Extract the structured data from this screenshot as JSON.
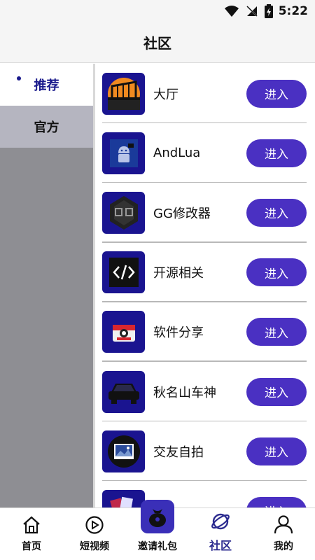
{
  "status_bar": {
    "time": "5:22"
  },
  "header": {
    "title": "社区"
  },
  "sidebar": {
    "items": [
      {
        "label": "推荐"
      },
      {
        "label": "官方"
      }
    ]
  },
  "list": {
    "items": [
      {
        "label": "大厅",
        "button": "进入",
        "icon": "bridge-icon"
      },
      {
        "label": "AndLua",
        "button": "进入",
        "icon": "android-robot-icon"
      },
      {
        "label": "GG修改器",
        "button": "进入",
        "icon": "gg-helmet-icon"
      },
      {
        "label": "开源相关",
        "button": "进入",
        "icon": "code-icon"
      },
      {
        "label": "软件分享",
        "button": "进入",
        "icon": "software-box-icon"
      },
      {
        "label": "秋名山车神",
        "button": "进入",
        "icon": "car-icon"
      },
      {
        "label": "交友自拍",
        "button": "进入",
        "icon": "photo-icon"
      },
      {
        "label": "",
        "button": "进入",
        "icon": "cards-icon"
      }
    ]
  },
  "bottom_nav": {
    "items": [
      {
        "label": "首页",
        "icon": "home-icon"
      },
      {
        "label": "短视频",
        "icon": "play-icon"
      },
      {
        "label": "邀请礼包",
        "icon": "gift-bag-icon"
      },
      {
        "label": "社区",
        "icon": "planet-icon"
      },
      {
        "label": "我的",
        "icon": "user-icon"
      }
    ]
  },
  "colors": {
    "accent": "#4a30c2",
    "icon_bg": "#1a1490",
    "active_text": "#1a1a8c"
  }
}
